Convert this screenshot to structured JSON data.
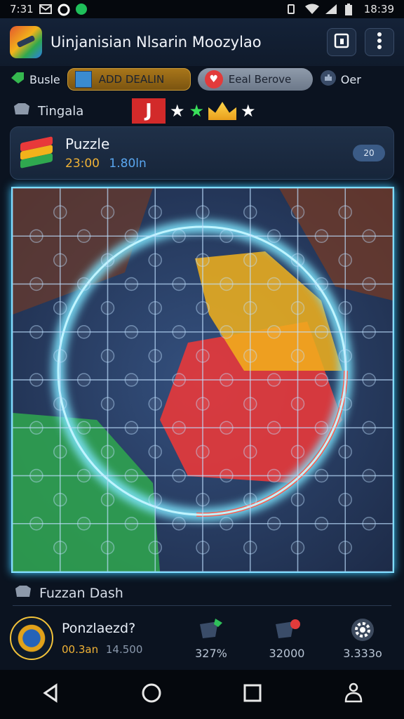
{
  "status_bar": {
    "time_left": "7:31",
    "clock": "18:39"
  },
  "app": {
    "title": "Uinjanisian Nlsarin Moozylao"
  },
  "filters": {
    "left_label": "Busle",
    "chip_gold_label": "ADD DEALIN",
    "chip_grey_label": "Eeal Berove",
    "right_label": "Oer"
  },
  "tags": {
    "label": "Tingala",
    "badge_letter": "J"
  },
  "puzzle_card": {
    "title": "Puzzle",
    "time": "23:00",
    "value": "1.80ln",
    "pill": "20"
  },
  "board": {
    "rows": 8,
    "cols": 8,
    "colors": {
      "red": "#e8393a",
      "yellow": "#f2b21b",
      "blue": "#2c4d86",
      "green": "#2fa84f",
      "glow": "#7fe6ff"
    }
  },
  "bottom": {
    "section_title": "Fuzzan Dash",
    "player_name": "Ponzlaezd?",
    "player_score": "00.3an",
    "player_score2": "14.500",
    "stats": [
      {
        "icon": "green-flag-icon",
        "value": "327%"
      },
      {
        "icon": "red-flag-icon",
        "value": "32000"
      },
      {
        "icon": "gear-icon",
        "value": "3.333o"
      }
    ]
  }
}
